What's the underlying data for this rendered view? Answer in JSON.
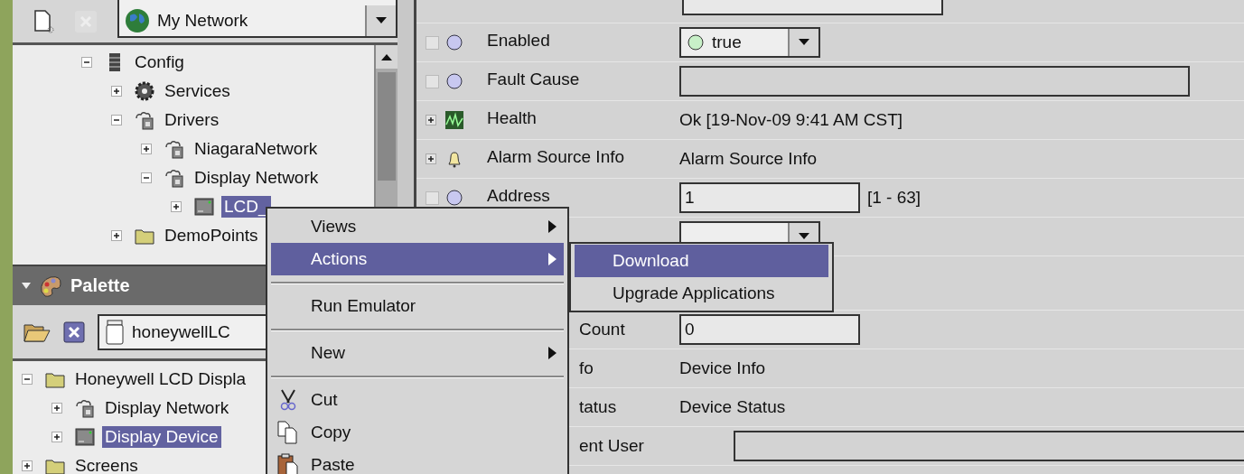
{
  "nav": {
    "selector": "My Network"
  },
  "nav_tree": [
    {
      "label": "Config",
      "kind": "config",
      "expanded": true,
      "selected": false,
      "children": [
        {
          "label": "Services",
          "kind": "services",
          "expanded": false,
          "selected": false
        },
        {
          "label": "Drivers",
          "kind": "driver",
          "expanded": true,
          "selected": false,
          "children": [
            {
              "label": "NiagaraNetwork",
              "kind": "driver",
              "expanded": false,
              "selected": false
            },
            {
              "label": "Display Network",
              "kind": "driver",
              "expanded": true,
              "selected": false,
              "children": [
                {
                  "label": "LCD_",
                  "kind": "device",
                  "expanded": false,
                  "selected": true
                }
              ]
            }
          ]
        },
        {
          "label": "DemoPoints",
          "kind": "folder",
          "expanded": false,
          "selected": false
        }
      ]
    }
  ],
  "palette": {
    "title": "Palette",
    "selector": "honeywellLC",
    "tree": [
      {
        "label": "Honeywell LCD Displa",
        "kind": "folder",
        "expanded": true,
        "selected": false,
        "children": [
          {
            "label": "Display Network",
            "kind": "driver",
            "expanded": false,
            "selected": false
          },
          {
            "label": "Display Device",
            "kind": "device",
            "expanded": false,
            "selected": true
          }
        ]
      },
      {
        "label": "Screens",
        "kind": "folder",
        "expanded": false,
        "selected": false
      }
    ]
  },
  "properties": [
    {
      "kind": "slot",
      "checked": false,
      "label": "Enabled",
      "value": {
        "kind": "dropdown",
        "text": "true"
      }
    },
    {
      "kind": "slot",
      "checked": false,
      "label": "Fault Cause",
      "value": {
        "kind": "long-field"
      }
    },
    {
      "kind": "health",
      "label": "Health",
      "value": {
        "kind": "text",
        "text": "Ok [19-Nov-09 9:41 AM CST]"
      }
    },
    {
      "kind": "alarm",
      "label": "Alarm Source Info",
      "value": {
        "kind": "text",
        "text": "Alarm Source Info"
      }
    },
    {
      "kind": "slot",
      "checked": false,
      "label": "Address",
      "value": {
        "kind": "field",
        "text": "1",
        "range": "[1 - 63]"
      }
    },
    {
      "kind": "covered",
      "value": {
        "kind": "dropdown"
      }
    },
    {
      "kind": "covered"
    },
    {
      "kind": "covered",
      "label": "Count",
      "value": {
        "kind": "field",
        "text": "0"
      }
    },
    {
      "kind": "covered",
      "label": "fo",
      "value": {
        "kind": "text",
        "text": "Device Info"
      }
    },
    {
      "kind": "covered",
      "label": "tatus",
      "value": {
        "kind": "text",
        "text": "Device Status"
      }
    },
    {
      "kind": "covered",
      "label": "ent User",
      "value": {
        "kind": "wide-field"
      }
    }
  ],
  "context_menu": [
    {
      "kind": "item",
      "label": "Views",
      "submenu": true,
      "selected": false
    },
    {
      "kind": "item",
      "label": "Actions",
      "submenu": true,
      "selected": true
    },
    {
      "kind": "separator"
    },
    {
      "kind": "item",
      "label": "Run Emulator",
      "submenu": false,
      "selected": false
    },
    {
      "kind": "separator"
    },
    {
      "kind": "item",
      "label": "New",
      "submenu": true,
      "selected": false
    },
    {
      "kind": "separator"
    },
    {
      "kind": "cut",
      "label": "Cut",
      "submenu": false,
      "selected": false
    },
    {
      "kind": "copy",
      "label": "Copy",
      "submenu": false,
      "selected": false
    },
    {
      "kind": "paste",
      "label": "Paste",
      "submenu": false,
      "selected": false
    }
  ],
  "submenu": [
    {
      "label": "Download",
      "selected": true
    },
    {
      "label": "Upgrade Applications",
      "selected": false
    }
  ]
}
